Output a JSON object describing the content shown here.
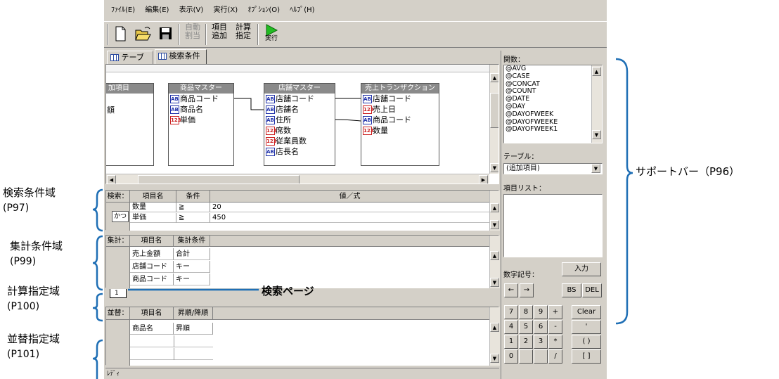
{
  "menu": [
    "ﾌｧｲﾙ(E)",
    "編集(E)",
    "表示(V)",
    "実行(X)",
    "ｵﾌﾟｼｮﾝ(O)",
    "ﾍﾙﾌﾟ(H)"
  ],
  "toolbar": {
    "auto_label": "自動\n割当",
    "add_item_label": "項目\n追加",
    "calc_label": "計算\n指定",
    "run_label": "実行"
  },
  "tabs": [
    "テーブル",
    "検索条件"
  ],
  "tables": {
    "partial_header": "加項目",
    "partial_item": "額",
    "product": {
      "title": "商品マスター",
      "fields": [
        [
          "AB",
          "商品コード"
        ],
        [
          "AB",
          "商品名"
        ],
        [
          "123",
          "単価"
        ]
      ]
    },
    "store": {
      "title": "店舗マスター",
      "fields": [
        [
          "AB",
          "店舗コード"
        ],
        [
          "AB",
          "店舗名"
        ],
        [
          "AB",
          "住所"
        ],
        [
          "123",
          "席数"
        ],
        [
          "123",
          "従業員数"
        ],
        [
          "AB",
          "店長名"
        ]
      ]
    },
    "sales": {
      "title": "売上トランザクション",
      "fields": [
        [
          "AB",
          "店舗コード"
        ],
        [
          "123",
          "売上日"
        ],
        [
          "AB",
          "商品コード"
        ],
        [
          "123",
          "数量"
        ]
      ]
    }
  },
  "search": {
    "label": "検索：",
    "col_item": "項目名",
    "col_cond": "条件",
    "col_value": "値／式",
    "conj": "かつ",
    "rows": [
      [
        "数量",
        "≧",
        "20"
      ],
      [
        "単価",
        "≧",
        "450"
      ]
    ]
  },
  "aggregate": {
    "label": "集計：",
    "col_item": "項目名",
    "col_cond": "集計条件",
    "rows": [
      [
        "売上金額",
        "合計"
      ],
      [
        "店舗コード",
        "キー"
      ],
      [
        "商品コード",
        "キー"
      ]
    ]
  },
  "page_tab": "1",
  "sort": {
    "label": "並替：",
    "col_item": "項目名",
    "col_order": "昇順/降順",
    "rows": [
      [
        "商品名",
        "昇順"
      ]
    ]
  },
  "status": "ﾚﾃﾞｨ",
  "support": {
    "functions_label": "関数：",
    "functions": [
      "@AVG",
      "@CASE",
      "@CONCAT",
      "@COUNT",
      "@DATE",
      "@DAY",
      "@DAYOFWEEK",
      "@DAYOFWEEKE",
      "@DAYOFWEEK1"
    ],
    "table_label": "テーブル：",
    "table_value": "(追加項目)",
    "items_label": "項目リスト：",
    "numsym_label": "数字記号：",
    "input_btn": "入力",
    "left_btn": "←",
    "right_btn": "→",
    "bs_btn": "BS",
    "del_btn": "DEL",
    "keypad": [
      [
        "7",
        "8",
        "9",
        "+"
      ],
      [
        "4",
        "5",
        "6",
        "-"
      ],
      [
        "1",
        "2",
        "3",
        "*"
      ],
      [
        "0",
        "",
        "",
        "/"
      ]
    ],
    "side_keys": [
      "Clear",
      "'",
      "(   )",
      "[   ]"
    ]
  },
  "annotations": {
    "search_area": "検索条件域",
    "search_page": "(P97)",
    "agg_area": "集計条件域",
    "agg_page": "(P99)",
    "calc_area": "計算指定域",
    "calc_page": "(P100)",
    "sort_area": "並替指定域",
    "sort_page": "(P101)",
    "support_bar": "サポートバー（P96）",
    "search_page_label": "検索ページ"
  }
}
